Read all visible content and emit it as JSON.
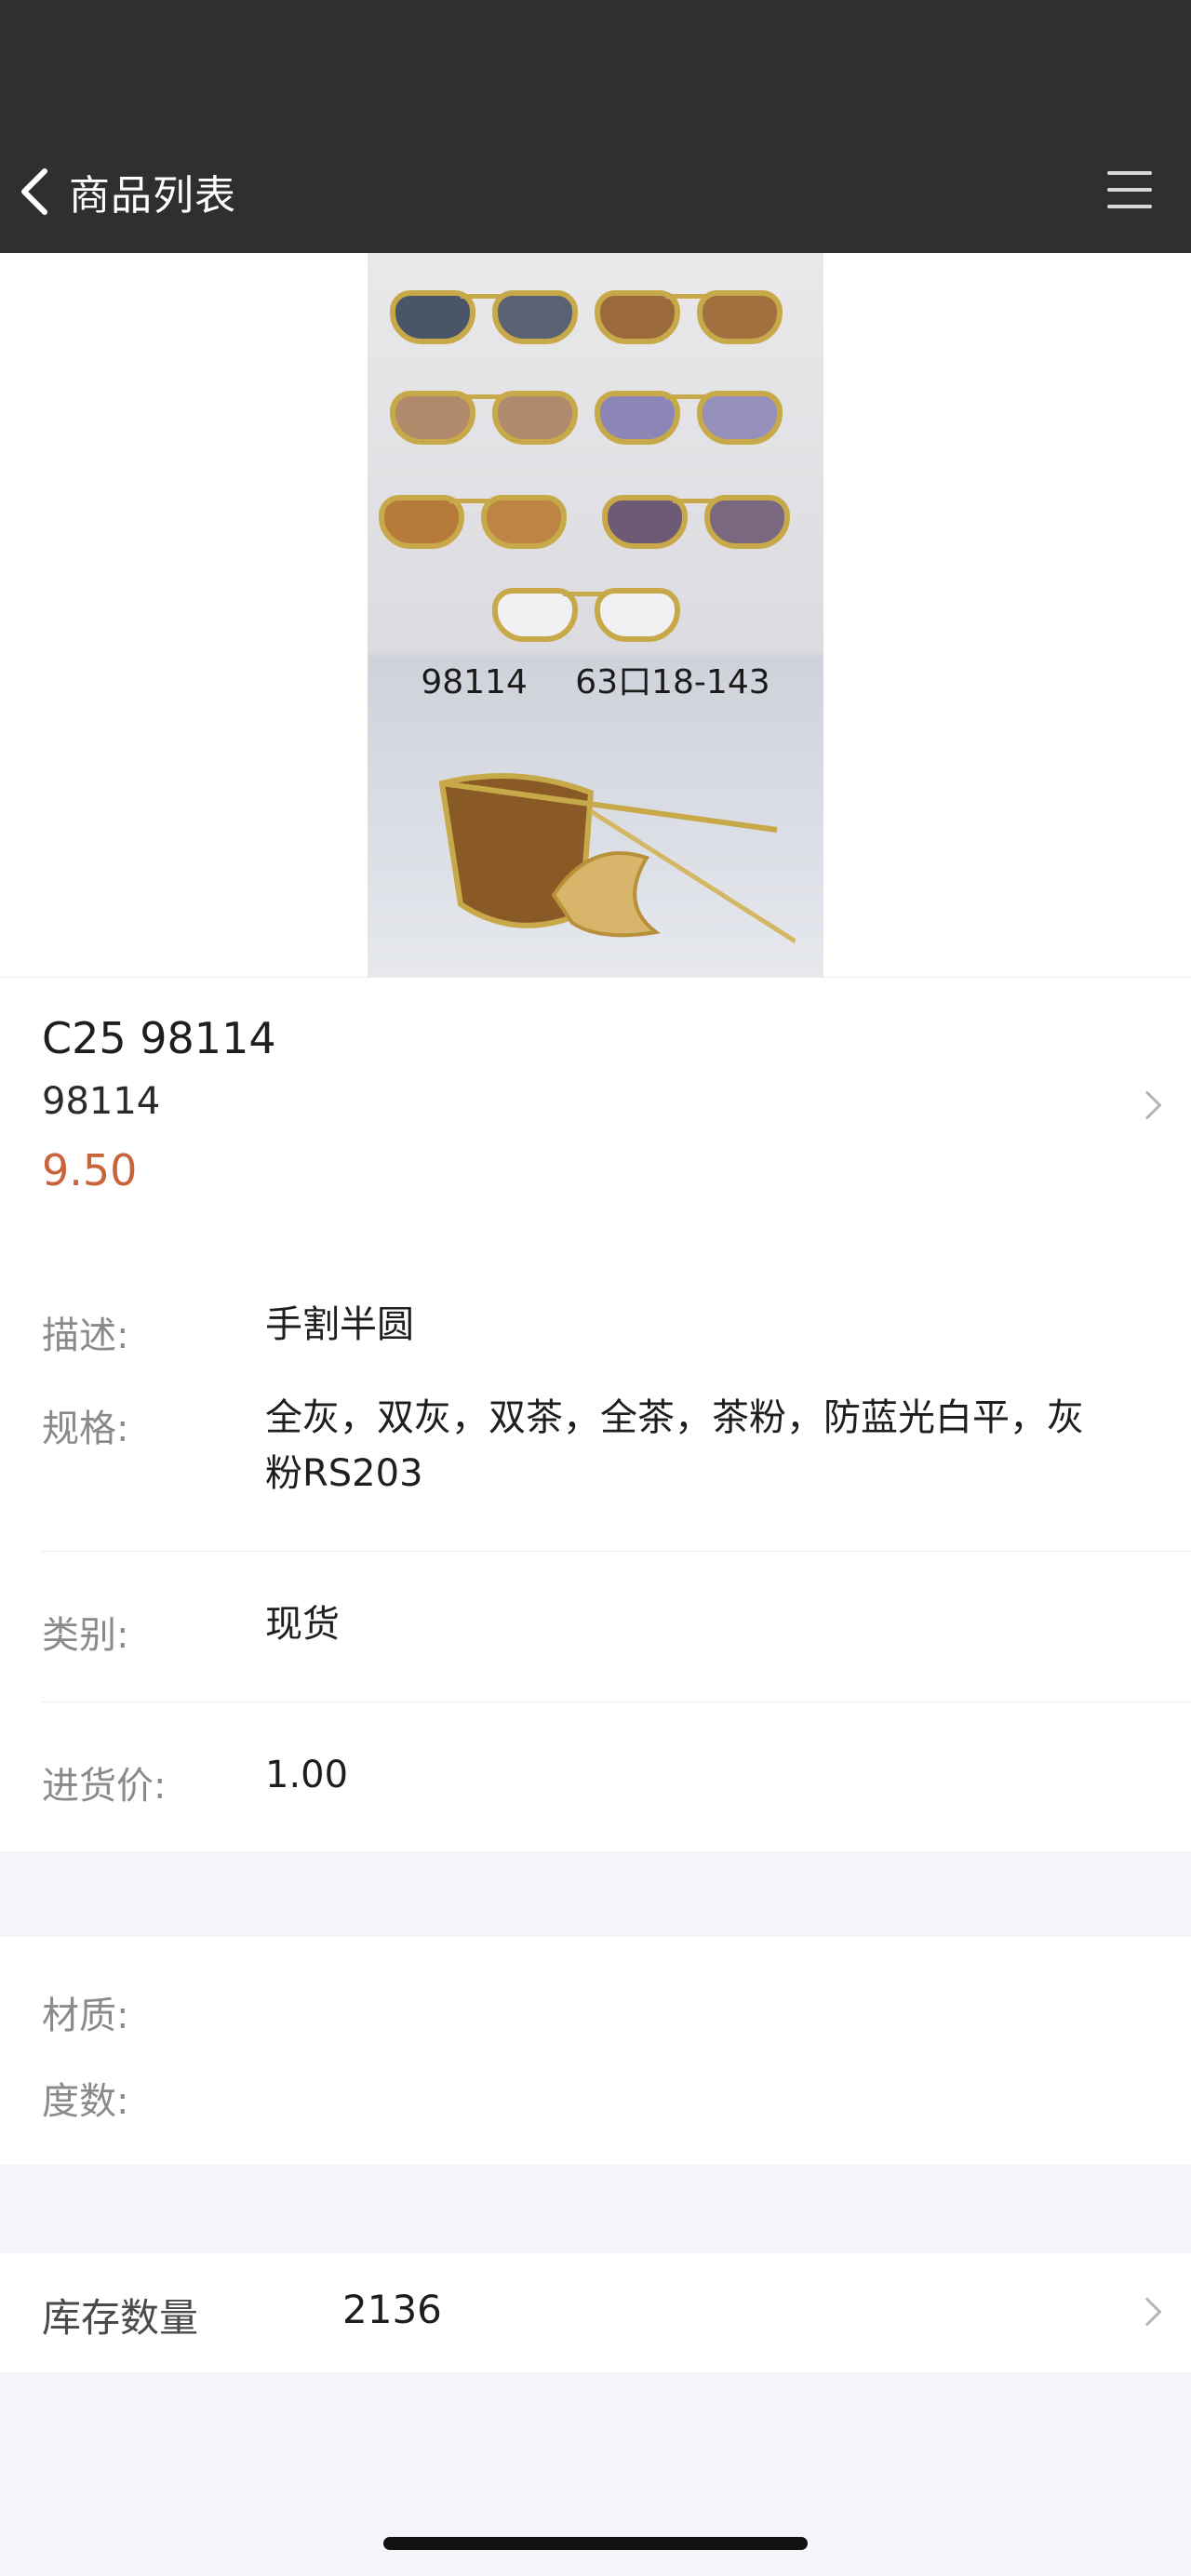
{
  "header": {
    "back_label": "商品列表",
    "menu_icon": "menu-icon",
    "background": "#2f2f2f"
  },
  "product": {
    "image_caption": "98114 63口18-143",
    "name": "C25 98114",
    "code": "98114",
    "price": "9.50",
    "price_color": "#c8633c"
  },
  "details": {
    "description_label": "描述:",
    "description_value": "手割半圆",
    "spec_label": "规格:",
    "spec_value_line1": "全灰，双灰，双茶，全茶，茶粉，防蓝光白平，灰",
    "spec_value_line2": "粉RS203",
    "category_label": "类别:",
    "category_value": "现货",
    "cost_label": "进货价:",
    "cost_value": "1.00"
  },
  "material": {
    "material_label": "材质:",
    "degree_label": "度数:"
  },
  "stock": {
    "label": "库存数量",
    "value": "2136"
  }
}
